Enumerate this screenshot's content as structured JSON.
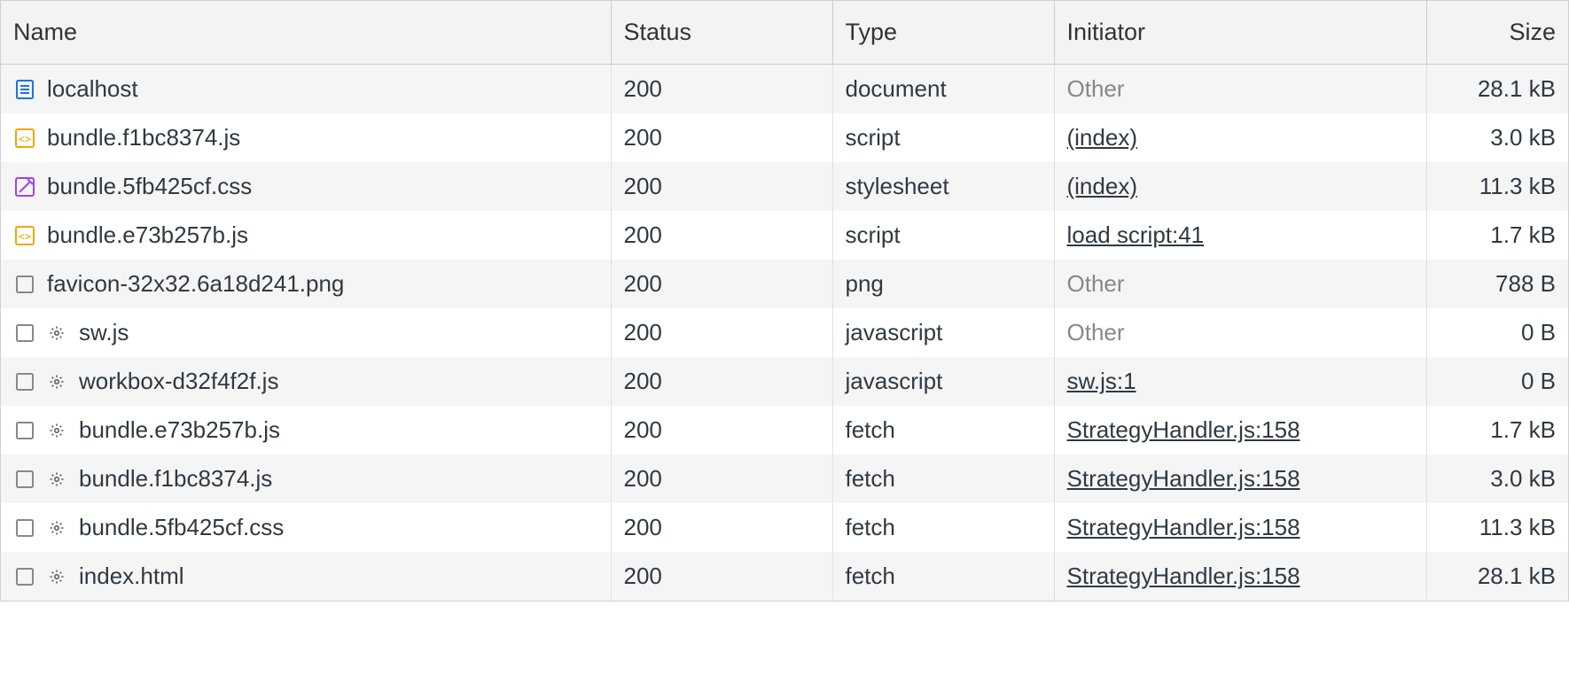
{
  "columns": {
    "name": "Name",
    "status": "Status",
    "type": "Type",
    "initiator": "Initiator",
    "size": "Size"
  },
  "rows": [
    {
      "icon": "document",
      "gear": false,
      "name": "localhost",
      "status": "200",
      "type": "document",
      "initiator": "Other",
      "initiator_linked": false,
      "size": "28.1 kB"
    },
    {
      "icon": "script",
      "gear": false,
      "name": "bundle.f1bc8374.js",
      "status": "200",
      "type": "script",
      "initiator": "(index)",
      "initiator_linked": true,
      "size": "3.0 kB"
    },
    {
      "icon": "css",
      "gear": false,
      "name": "bundle.5fb425cf.css",
      "status": "200",
      "type": "stylesheet",
      "initiator": "(index)",
      "initiator_linked": true,
      "size": "11.3 kB"
    },
    {
      "icon": "script",
      "gear": false,
      "name": "bundle.e73b257b.js",
      "status": "200",
      "type": "script",
      "initiator": "load script:41",
      "initiator_linked": true,
      "size": "1.7 kB"
    },
    {
      "icon": "blank",
      "gear": false,
      "name": "favicon-32x32.6a18d241.png",
      "status": "200",
      "type": "png",
      "initiator": "Other",
      "initiator_linked": false,
      "size": "788 B"
    },
    {
      "icon": "blank",
      "gear": true,
      "name": "sw.js",
      "status": "200",
      "type": "javascript",
      "initiator": "Other",
      "initiator_linked": false,
      "size": "0 B"
    },
    {
      "icon": "blank",
      "gear": true,
      "name": "workbox-d32f4f2f.js",
      "status": "200",
      "type": "javascript",
      "initiator": "sw.js:1",
      "initiator_linked": true,
      "size": "0 B"
    },
    {
      "icon": "blank",
      "gear": true,
      "name": "bundle.e73b257b.js",
      "status": "200",
      "type": "fetch",
      "initiator": "StrategyHandler.js:158",
      "initiator_linked": true,
      "size": "1.7 kB"
    },
    {
      "icon": "blank",
      "gear": true,
      "name": "bundle.f1bc8374.js",
      "status": "200",
      "type": "fetch",
      "initiator": "StrategyHandler.js:158",
      "initiator_linked": true,
      "size": "3.0 kB"
    },
    {
      "icon": "blank",
      "gear": true,
      "name": "bundle.5fb425cf.css",
      "status": "200",
      "type": "fetch",
      "initiator": "StrategyHandler.js:158",
      "initiator_linked": true,
      "size": "11.3 kB"
    },
    {
      "icon": "blank",
      "gear": true,
      "name": "index.html",
      "status": "200",
      "type": "fetch",
      "initiator": "StrategyHandler.js:158",
      "initiator_linked": true,
      "size": "28.1 kB"
    }
  ]
}
